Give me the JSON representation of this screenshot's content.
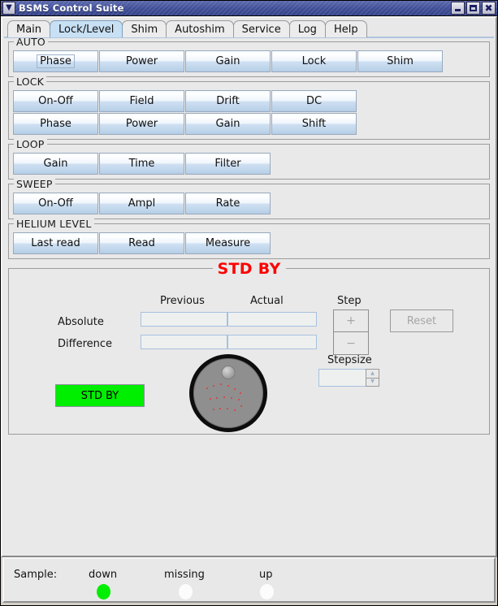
{
  "window": {
    "title": "BSMS Control Suite",
    "sysmenu_icon": "chevron-down-icon",
    "minimize_label": "minimize-icon",
    "maximize_label": "maximize-icon",
    "close_label": "close-icon"
  },
  "tabs": [
    {
      "label": "Main",
      "selected": false
    },
    {
      "label": "Lock/Level",
      "selected": true
    },
    {
      "label": "Shim",
      "selected": false
    },
    {
      "label": "Autoshim",
      "selected": false
    },
    {
      "label": "Service",
      "selected": false
    },
    {
      "label": "Log",
      "selected": false
    },
    {
      "label": "Help",
      "selected": false
    }
  ],
  "groups": [
    {
      "title": "AUTO",
      "rows": [
        [
          "Phase",
          "Power",
          "Gain",
          "Lock",
          "Shim"
        ]
      ],
      "focused_button": "Phase"
    },
    {
      "title": "LOCK",
      "rows": [
        [
          "On-Off",
          "Field",
          "Drift",
          "DC"
        ],
        [
          "Phase",
          "Power",
          "Gain",
          "Shift"
        ]
      ]
    },
    {
      "title": "LOOP",
      "rows": [
        [
          "Gain",
          "Time",
          "Filter"
        ]
      ]
    },
    {
      "title": "SWEEP",
      "rows": [
        [
          "On-Off",
          "Ampl",
          "Rate"
        ]
      ]
    },
    {
      "title": "HELIUM LEVEL",
      "rows": [
        [
          "Last read",
          "Read",
          "Measure"
        ]
      ]
    }
  ],
  "control_panel": {
    "title": "STD BY",
    "title_color": "#ff0000",
    "column_headers": {
      "previous": "Previous",
      "actual": "Actual"
    },
    "row_labels": {
      "absolute": "Absolute",
      "difference": "Difference"
    },
    "values": {
      "absolute_previous": "",
      "absolute_actual": "",
      "difference_previous": "",
      "difference_actual": ""
    },
    "step": {
      "label": "Step",
      "plus_label": "+",
      "minus_label": "−",
      "enabled": false
    },
    "reset": {
      "label": "Reset",
      "enabled": false
    },
    "stepsize": {
      "label": "Stepsize",
      "value": "",
      "up_icon": "triangle-up-icon",
      "down_icon": "triangle-down-icon"
    },
    "status_button": {
      "label": "STD BY",
      "color": "#00ee00"
    },
    "knob": {
      "name": "rotary-knob",
      "indicator": "knob-position-indicator"
    }
  },
  "statusbar": {
    "label": "Sample:",
    "indicators": [
      {
        "label": "down",
        "state": "on",
        "color": "#00ee00"
      },
      {
        "label": "missing",
        "state": "off",
        "color": "#fcfcfc"
      },
      {
        "label": "up",
        "state": "off",
        "color": "#fcfcfc"
      }
    ]
  }
}
